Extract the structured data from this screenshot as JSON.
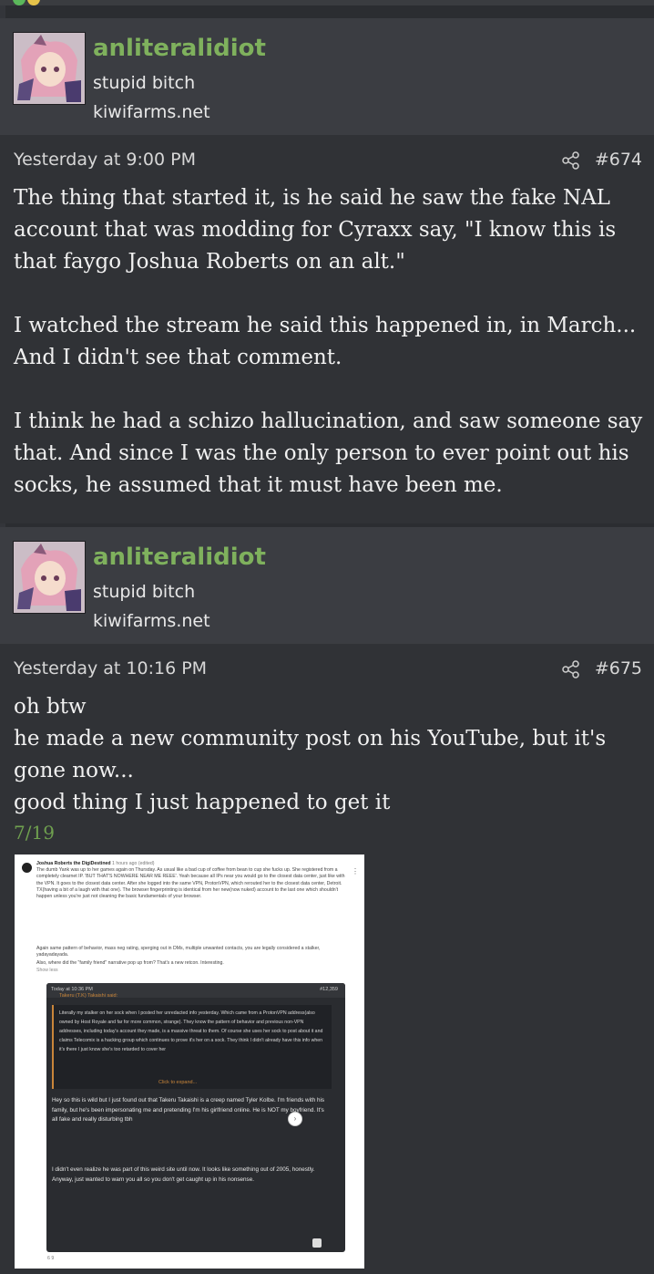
{
  "posts": [
    {
      "username": "anliteralidiot",
      "user_title": "stupid bitch",
      "user_domain": "kiwifarms.net",
      "timestamp": "Yesterday at 9:00 PM",
      "post_number": "#674",
      "paragraphs": [
        "The thing that started it, is he said he saw the fake NAL account that was modding for Cyraxx say, \"I know this is that faygo Joshua Roberts on an alt.\"",
        "I watched the stream he said this happened in, in March... And I didn't see that comment.",
        "I think he had a schizo hallucination, and saw someone say that. And since I was the only person to ever point out his socks, he assumed that it must have been me."
      ]
    },
    {
      "username": "anliteralidiot",
      "user_title": "stupid bitch",
      "user_domain": "kiwifarms.net",
      "timestamp": "Yesterday at 10:16 PM",
      "post_number": "#675",
      "lines": [
        "oh btw",
        "he made a new community post on his YouTube, but it's gone now...",
        "good thing I just happened to get it"
      ],
      "date_link": "7/19"
    }
  ],
  "embedded_screenshot": {
    "channel": "Joshua Roberts the DigiDestined",
    "age": "1 hours ago (edited)",
    "post_text": "The dumb Yank was up to her games again on Thursday. As usual like a bad cup of coffee from bean to cup she fucks up. She registered from a completely clearnet IP. 'BUT THAT'S NOWHERE NEAR ME REEE'. Yeah because all IPs near you would go to the closest data center, just like with the VPN. It goes to the closest data center. After she logged into the same VPN, ProtonVPN, which rerouted her to the closest data center, Detroit. TX(having a bit of a laugh with that one). The browser fingerprinting is identical from her new(now nuked) account to the last one which shouldn't happen unless you're just not cleaning the basic fundamentals of your browser.",
    "post_text_2": "Again same pattern of behavior, mass neg rating, sperging out in DMs, multiple unwanted contacts, you are legally considered a stalker, yadayadayada.",
    "post_text_3": "Also, where did the \"family friend\" narrative pop up from? That's a new retcon. Interesting.",
    "show_less": "Show less",
    "quote_time": "Today at 10:36 PM",
    "quote_number": "#12,359",
    "quote_author": "Takeru (T.K) Takaishi said:",
    "quote_body": "Literally my stalker on her sock when I posted her unredacted info yesterday. Which came from a ProtonVPN address(also owned by Host Royale and far for more common, strange). They know the pattern of behavior and previous non-VPN addresses, including today's account they made, is a massive threat to them. Of course she uses her sock to post about it and claims Telecomix is a hacking group which continues to prove it's her on a sock. They think I didn't already have this info when it's there I just know she's too retarded to cover her",
    "expand": "Click to expand...",
    "reply_1": "Hey so this is wild but I just found out that Takeru Takaishi is a creep named Tyler Kolbe. I'm friends with his family, but he's been impersonating me and pretending I'm his girlfriend online. He is NOT my boyfriend. It's all fake and really disturbing tbh",
    "reply_2": "I didn't even realize he was part of this weird site until now. It looks like something out of 2005, honestly. Anyway, just wanted to warn you all so you don't get caught up in his nonsense.",
    "footer": "6  9"
  },
  "colors": {
    "username": "#7fb15d",
    "link": "#6fa04f",
    "background": "#2b2d31",
    "header": "#3b3d42"
  }
}
